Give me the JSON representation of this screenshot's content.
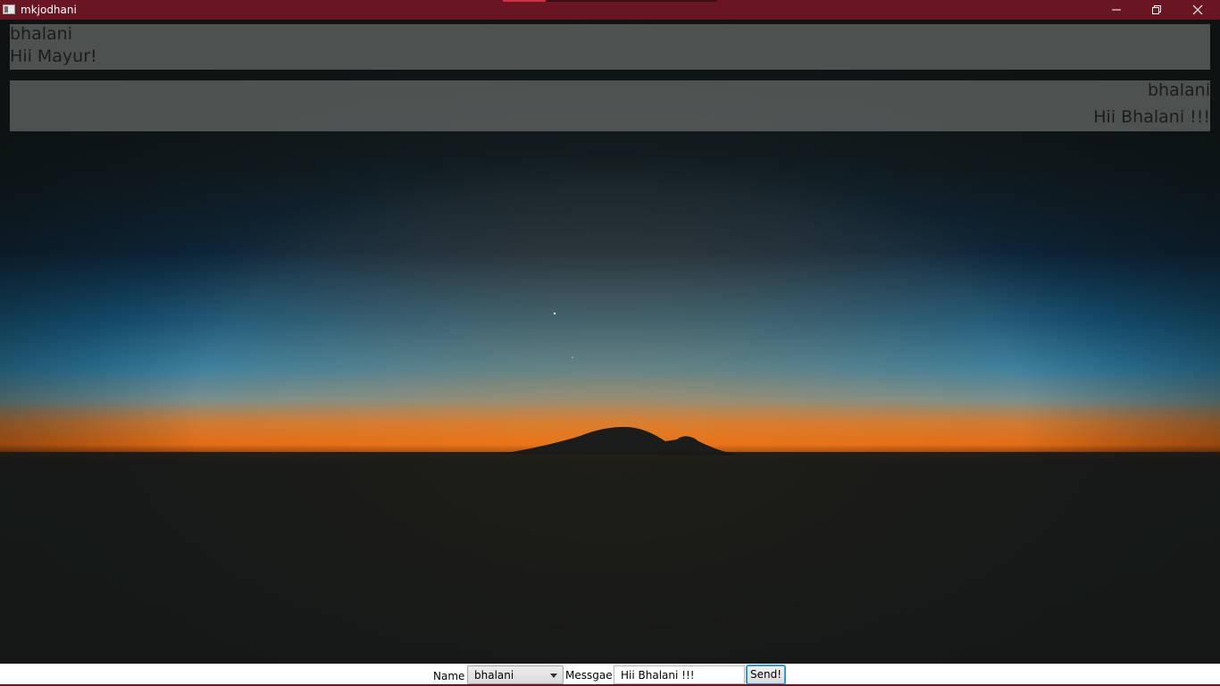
{
  "window": {
    "title": "mkjodhani"
  },
  "messages": [
    {
      "sender": "bhalani",
      "text": "Hii Mayur!",
      "align": "left"
    },
    {
      "sender": "bhalani",
      "text": "Hii Bhalani !!!",
      "align": "right"
    }
  ],
  "form": {
    "name_label": "Name :",
    "name_selected": "bhalani",
    "message_label": "Messgae :",
    "message_value": "Hii Bhalani !!!",
    "send_label": "Send!"
  },
  "colors": {
    "titlebar": "#6a1522",
    "send_focus_border": "#2a9bd6",
    "bubble": "#787d7a"
  },
  "icons": {
    "app": "app-window-icon",
    "minimize": "minimize-icon",
    "maximize": "restore-icon",
    "close": "close-icon",
    "dropdown": "chevron-down-icon"
  }
}
